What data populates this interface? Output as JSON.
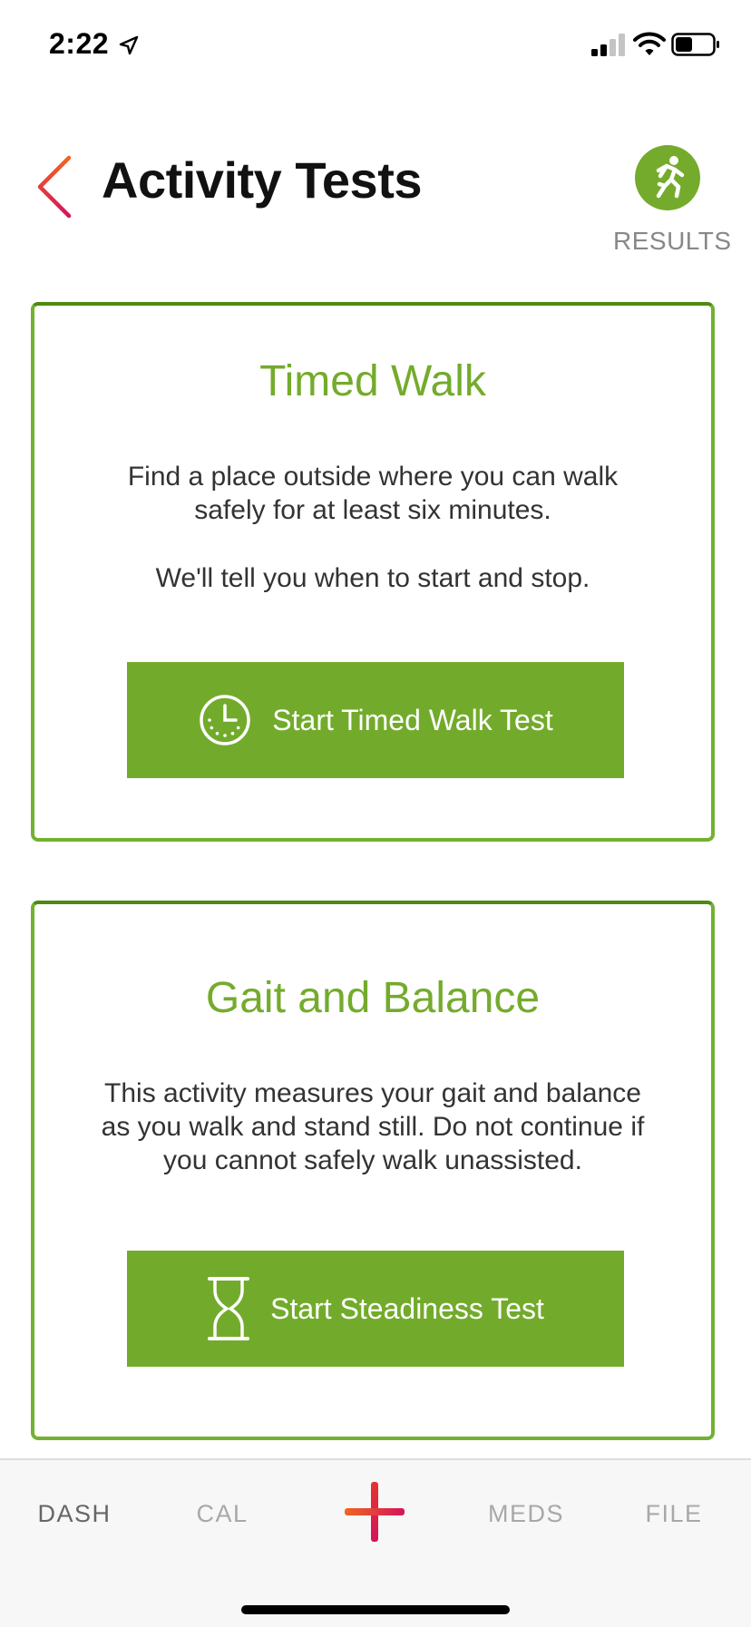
{
  "status_bar": {
    "time": "2:22",
    "icons": [
      "location-arrow-icon",
      "cell-signal-icon",
      "wifi-icon",
      "battery-icon"
    ]
  },
  "header": {
    "title": "Activity Tests",
    "back_icon": "chevron-left-icon",
    "results_label": "RESULTS",
    "results_icon": "running-person-icon"
  },
  "cards": {
    "timed_walk": {
      "title": "Timed Walk",
      "description_1": "Find a place outside where you can walk safely for at least six minutes.",
      "description_2": "We'll tell you when to start and stop.",
      "button_label": "Start Timed Walk Test",
      "button_icon": "clock-icon"
    },
    "gait_balance": {
      "title": "Gait and Balance",
      "description": "This activity measures your gait and balance as you walk and stand still. Do not continue if you cannot safely walk unassisted.",
      "button_label": "Start Steadiness Test",
      "button_icon": "hourglass-icon"
    }
  },
  "tab_bar": {
    "tabs": [
      {
        "label": "DASH",
        "active": true
      },
      {
        "label": "CAL",
        "active": false
      },
      {
        "label": "MEDS",
        "active": false
      },
      {
        "label": "FILE",
        "active": false
      }
    ],
    "center_icon": "plus-icon"
  },
  "colors": {
    "accent_green": "#74ab2c",
    "button_green": "#72ab2b",
    "card_border": "#72b132",
    "gradient_start": "#f26522",
    "gradient_end": "#d4145a"
  }
}
